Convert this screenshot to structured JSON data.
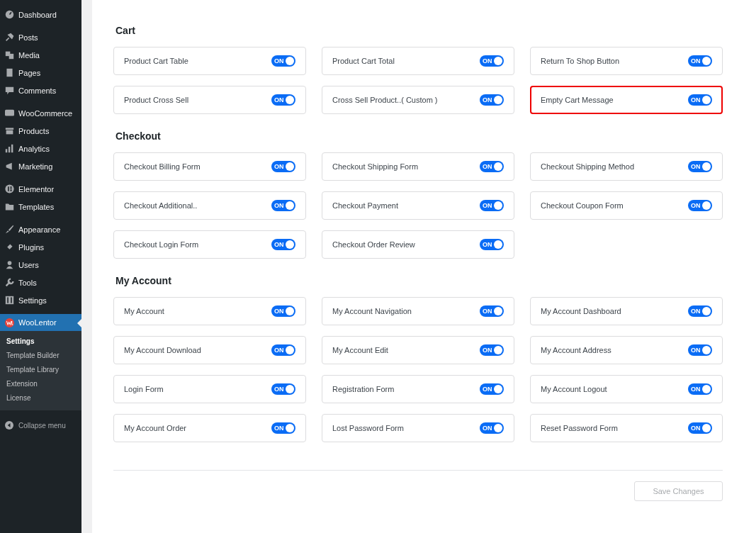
{
  "sidebar": {
    "groups": [
      [
        {
          "label": "Dashboard",
          "selected": false
        }
      ],
      [
        {
          "label": "Posts",
          "selected": false
        },
        {
          "label": "Media",
          "selected": false
        },
        {
          "label": "Pages",
          "selected": false
        },
        {
          "label": "Comments",
          "selected": false
        }
      ],
      [
        {
          "label": "WooCommerce",
          "selected": false
        },
        {
          "label": "Products",
          "selected": false
        },
        {
          "label": "Analytics",
          "selected": false
        },
        {
          "label": "Marketing",
          "selected": false
        }
      ],
      [
        {
          "label": "Elementor",
          "selected": false
        },
        {
          "label": "Templates",
          "selected": false
        }
      ],
      [
        {
          "label": "Appearance",
          "selected": false
        },
        {
          "label": "Plugins",
          "selected": false
        },
        {
          "label": "Users",
          "selected": false
        },
        {
          "label": "Tools",
          "selected": false
        },
        {
          "label": "Settings",
          "selected": false
        }
      ],
      [
        {
          "label": "WooLentor",
          "selected": true,
          "children": [
            {
              "label": "Settings",
              "selected": true
            },
            {
              "label": "Template Builder",
              "selected": false
            },
            {
              "label": "Template Library",
              "selected": false
            },
            {
              "label": "Extension",
              "selected": false
            },
            {
              "label": "License",
              "selected": false
            }
          ]
        }
      ]
    ],
    "collapse": "Collapse menu"
  },
  "sections": [
    {
      "title": "Cart",
      "items": [
        {
          "label": "Product Cart Table",
          "on": true,
          "switch_text": "ON",
          "highlighted": false
        },
        {
          "label": "Product Cart Total",
          "on": true,
          "switch_text": "ON",
          "highlighted": false
        },
        {
          "label": "Return To Shop Button",
          "on": true,
          "switch_text": "ON",
          "highlighted": false
        },
        {
          "label": "Product Cross Sell",
          "on": true,
          "switch_text": "ON",
          "highlighted": false
        },
        {
          "label": "Cross Sell Product..( Custom )",
          "on": true,
          "switch_text": "ON",
          "highlighted": false
        },
        {
          "label": "Empty Cart Message",
          "on": true,
          "switch_text": "ON",
          "highlighted": true
        }
      ]
    },
    {
      "title": "Checkout",
      "items": [
        {
          "label": "Checkout Billing Form",
          "on": true,
          "switch_text": "ON",
          "highlighted": false
        },
        {
          "label": "Checkout Shipping Form",
          "on": true,
          "switch_text": "ON",
          "highlighted": false
        },
        {
          "label": "Checkout Shipping Method",
          "on": true,
          "switch_text": "ON",
          "highlighted": false
        },
        {
          "label": "Checkout Additional..",
          "on": true,
          "switch_text": "ON",
          "highlighted": false
        },
        {
          "label": "Checkout Payment",
          "on": true,
          "switch_text": "ON",
          "highlighted": false
        },
        {
          "label": "Checkout Coupon Form",
          "on": true,
          "switch_text": "ON",
          "highlighted": false
        },
        {
          "label": "Checkout Login Form",
          "on": true,
          "switch_text": "ON",
          "highlighted": false
        },
        {
          "label": "Checkout Order Review",
          "on": true,
          "switch_text": "ON",
          "highlighted": false
        }
      ]
    },
    {
      "title": "My Account",
      "items": [
        {
          "label": "My Account",
          "on": true,
          "switch_text": "ON",
          "highlighted": false
        },
        {
          "label": "My Account Navigation",
          "on": true,
          "switch_text": "ON",
          "highlighted": false
        },
        {
          "label": "My Account Dashboard",
          "on": true,
          "switch_text": "ON",
          "highlighted": false
        },
        {
          "label": "My Account Download",
          "on": true,
          "switch_text": "ON",
          "highlighted": false
        },
        {
          "label": "My Account Edit",
          "on": true,
          "switch_text": "ON",
          "highlighted": false
        },
        {
          "label": "My Account Address",
          "on": true,
          "switch_text": "ON",
          "highlighted": false
        },
        {
          "label": "Login Form",
          "on": true,
          "switch_text": "ON",
          "highlighted": false
        },
        {
          "label": "Registration Form",
          "on": true,
          "switch_text": "ON",
          "highlighted": false
        },
        {
          "label": "My Account Logout",
          "on": true,
          "switch_text": "ON",
          "highlighted": false
        },
        {
          "label": "My Account Order",
          "on": true,
          "switch_text": "ON",
          "highlighted": false
        },
        {
          "label": "Lost Password Form",
          "on": true,
          "switch_text": "ON",
          "highlighted": false
        },
        {
          "label": "Reset Password Form",
          "on": true,
          "switch_text": "ON",
          "highlighted": false
        }
      ]
    }
  ],
  "save_button": {
    "label": "Save Changes",
    "disabled": true
  }
}
